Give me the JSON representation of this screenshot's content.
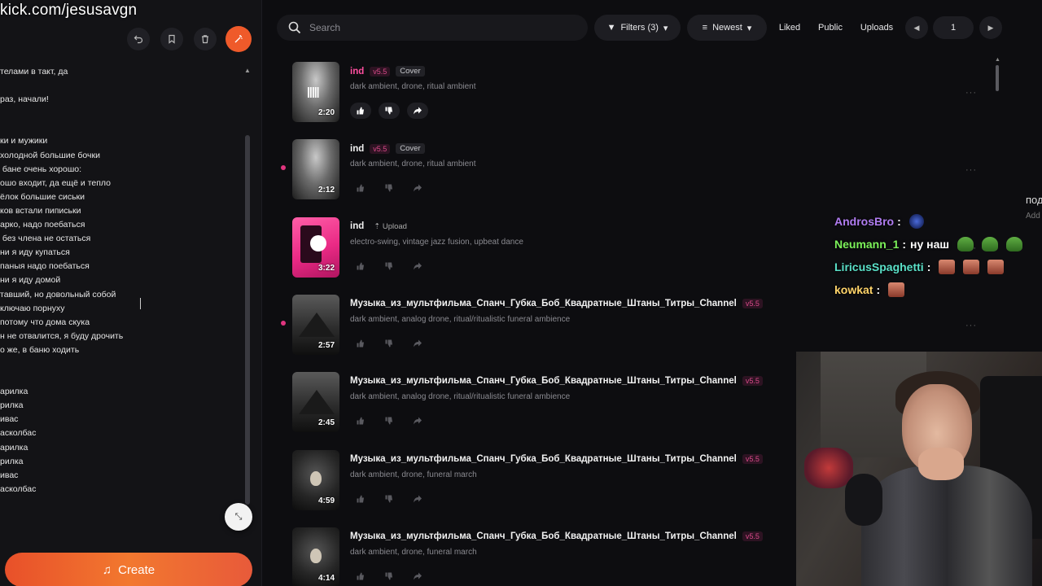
{
  "overlay": {
    "stream_url": "kick.com/jesusavgn"
  },
  "editor": {
    "lyrics": [
      "телами в такт, да",
      "",
      "раз, начали!",
      "",
      "",
      "ки и мужики",
      "холодной большие бочки",
      " бане очень хорошо:",
      "ошо входит, да ещё и тепло",
      "ёлок большие сиськи",
      "ков встали пиписьки",
      "арко, надо поебаться",
      " без члена не остаться",
      "ни я иду купаться",
      "паныя надо поебаться",
      "ни я иду домой",
      "тавший, но довольный собой",
      "ключаю порнуху",
      "потому что дома скука",
      "н не отвалится, я буду дрочить",
      "о же, в баню ходить",
      "",
      "",
      "арилка",
      "рилка",
      "ивас",
      "асколбас",
      "арилка",
      "рилка",
      "ивас",
      "асколбас"
    ],
    "create_label": "Create"
  },
  "toolbar": {
    "search_placeholder": "Search",
    "filters_label": "Filters (3)",
    "sort_label": "Newest",
    "liked_label": "Liked",
    "public_label": "Public",
    "uploads_label": "Uploads",
    "page": "1"
  },
  "songs": [
    {
      "title": "ind",
      "title_pink": true,
      "version": "v5.5",
      "tag": "Cover",
      "genres": "dark ambient, drone, ritual ambient",
      "duration": "2:20",
      "thumb": "mist",
      "playing": true,
      "dot": false,
      "actions_bright": true
    },
    {
      "title": "ind",
      "title_pink": false,
      "version": "v5.5",
      "tag": "Cover",
      "genres": "dark ambient, drone, ritual ambient",
      "duration": "2:12",
      "thumb": "mist",
      "playing": false,
      "dot": true,
      "actions_bright": false
    },
    {
      "title": "ind",
      "title_pink": false,
      "version": "",
      "tag": "Upload",
      "genres": "electro-swing, vintage jazz fusion, upbeat dance",
      "duration": "3:22",
      "thumb": "pink",
      "playing": false,
      "dot": false,
      "actions_bright": false
    },
    {
      "title": "Музыка_из_мультфильма_Спанч_Губка_Боб_Квадратные_Штаны_Титры_Channel",
      "title_pink": false,
      "version": "v5.5",
      "tag": "",
      "genres": "dark ambient, analog drone, ritual/ritualistic funeral ambience",
      "duration": "2:57",
      "thumb": "mountain",
      "playing": false,
      "dot": true,
      "actions_bright": false
    },
    {
      "title": "Музыка_из_мультфильма_Спанч_Губка_Боб_Квадратные_Штаны_Титры_Channel",
      "title_pink": false,
      "version": "v5.5",
      "tag": "",
      "genres": "dark ambient, analog drone, ritual/ritualistic funeral ambience",
      "duration": "2:45",
      "thumb": "mountain",
      "playing": false,
      "dot": false,
      "actions_bright": false
    },
    {
      "title": "Музыка_из_мультфильма_Спанч_Губка_Боб_Квадратные_Штаны_Титры_Channel",
      "title_pink": false,
      "version": "v5.5",
      "tag": "",
      "genres": "dark ambient, drone, funeral march",
      "duration": "4:59",
      "thumb": "egg",
      "playing": false,
      "dot": false,
      "actions_bright": false
    },
    {
      "title": "Музыка_из_мультфильма_Спанч_Губка_Боб_Квадратные_Штаны_Титры_Channel",
      "title_pink": false,
      "version": "v5.5",
      "tag": "",
      "genres": "dark ambient, drone, funeral march",
      "duration": "4:14",
      "thumb": "egg",
      "playing": false,
      "dot": false,
      "actions_bright": false
    }
  ],
  "chat": [
    {
      "user": "AndrosBro",
      "color": "#b07cf0",
      "message": "",
      "emotes": [
        "robot"
      ]
    },
    {
      "user": "Neumann_1",
      "color": "#7cf25a",
      "message": "ну наш",
      "emotes": [
        "frog",
        "frog",
        "frog"
      ]
    },
    {
      "user": "LiricusSpaghetti",
      "color": "#5ae0c8",
      "message": "",
      "emotes": [
        "face",
        "face",
        "face"
      ]
    },
    {
      "user": "kowkat",
      "color": "#ffd46a",
      "message": "",
      "emotes": [
        "face"
      ]
    }
  ],
  "side_hint": {
    "text": "под",
    "subtext": "Add"
  },
  "colors": {
    "accent": "#ef5a2a",
    "pink": "#e0357f"
  }
}
